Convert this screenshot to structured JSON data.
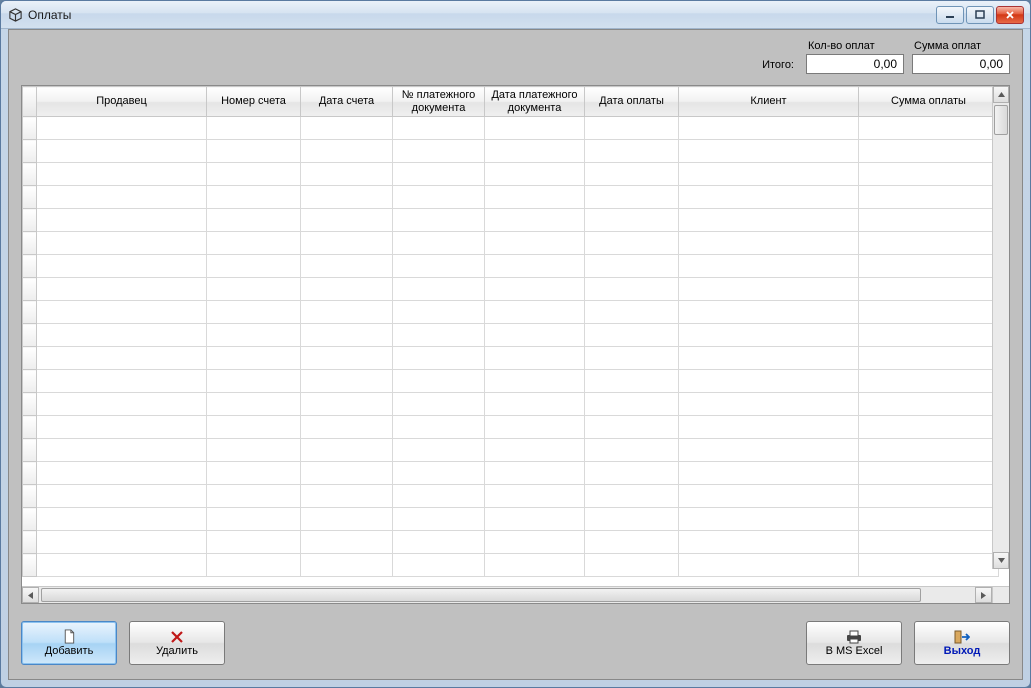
{
  "window": {
    "title": "Оплаты"
  },
  "summary": {
    "total_label": "Итого:",
    "count_label": "Кол-во оплат",
    "count_value": "0,00",
    "sum_label": "Сумма оплат",
    "sum_value": "0,00"
  },
  "grid": {
    "columns": [
      "Продавец",
      "Номер счета",
      "Дата счета",
      "№ платежного документа",
      "Дата платежного документа",
      "Дата оплаты",
      "Клиент",
      "Сумма оплаты"
    ],
    "rows": []
  },
  "buttons": {
    "add": "Добавить",
    "delete": "Удалить",
    "excel": "B MS Excel",
    "exit": "Выход"
  }
}
